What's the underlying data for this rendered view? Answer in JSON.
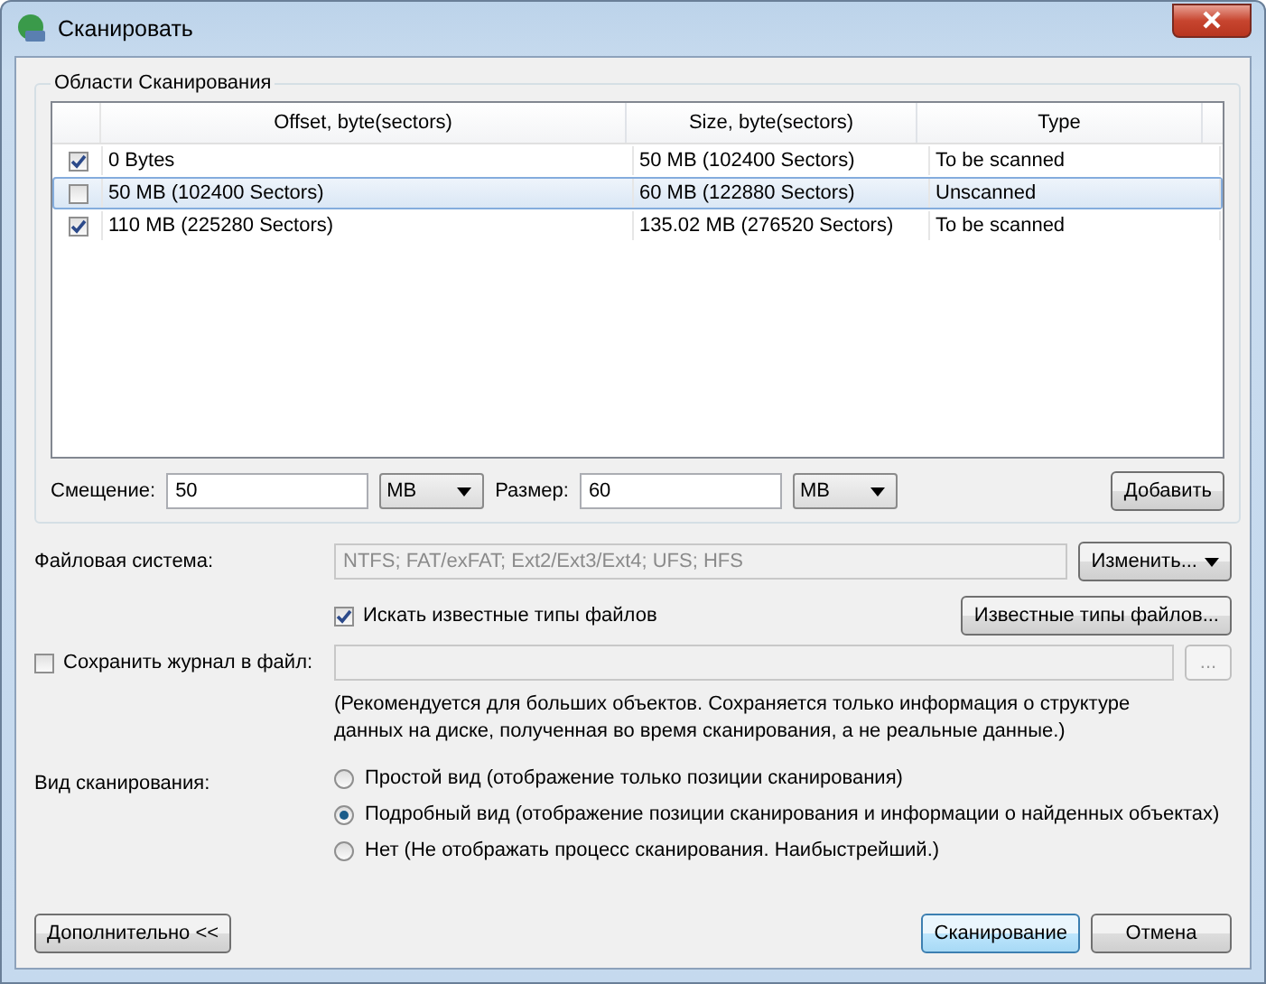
{
  "window": {
    "title": "Сканировать"
  },
  "scan_areas": {
    "title": "Области Сканирования",
    "columns": [
      "Offset, byte(sectors)",
      "Size, byte(sectors)",
      "Type"
    ],
    "rows": [
      {
        "checked": true,
        "selected": false,
        "offset": "0 Bytes",
        "size": "50 MB (102400 Sectors)",
        "type": "To be scanned"
      },
      {
        "checked": false,
        "selected": true,
        "offset": "50 MB (102400 Sectors)",
        "size": "60 MB (122880 Sectors)",
        "type": "Unscanned"
      },
      {
        "checked": true,
        "selected": false,
        "offset": "110 MB (225280 Sectors)",
        "size": "135.02 MB (276520 Sectors)",
        "type": "To be scanned"
      }
    ],
    "offset_field": {
      "label": "Смещение:",
      "value": "50",
      "unit": "MB"
    },
    "size_field": {
      "label": "Размер:",
      "value": "60",
      "unit": "MB"
    },
    "add_button": "Добавить"
  },
  "file_system": {
    "label": "Файловая система:",
    "value": "NTFS; FAT/exFAT; Ext2/Ext3/Ext4; UFS; HFS",
    "button": "Изменить..."
  },
  "search_known": {
    "label": "Искать известные типы файлов",
    "checked": true
  },
  "known_types_button": "Известные типы файлов...",
  "save_log": {
    "label": "Сохранить журнал в файл:",
    "checked": false,
    "browse_button": "...",
    "note": "(Рекомендуется для больших объектов. Сохраняется только информация о структуре данных на диске, полученная во время сканирования, а не реальные данные.)"
  },
  "scan_view": {
    "label": "Вид сканирования:",
    "options": [
      {
        "label": "Простой вид (отображение только позиции сканирования)",
        "selected": false
      },
      {
        "label": "Подробный вид (отображение позиции сканирования и информации о найденных объектах)",
        "selected": true
      },
      {
        "label": "Нет (Не отображать процесс сканирования. Наибыстрейший.)",
        "selected": false
      }
    ]
  },
  "buttons": {
    "advanced": "Дополнительно <<",
    "scan": "Сканирование",
    "cancel": "Отмена"
  }
}
